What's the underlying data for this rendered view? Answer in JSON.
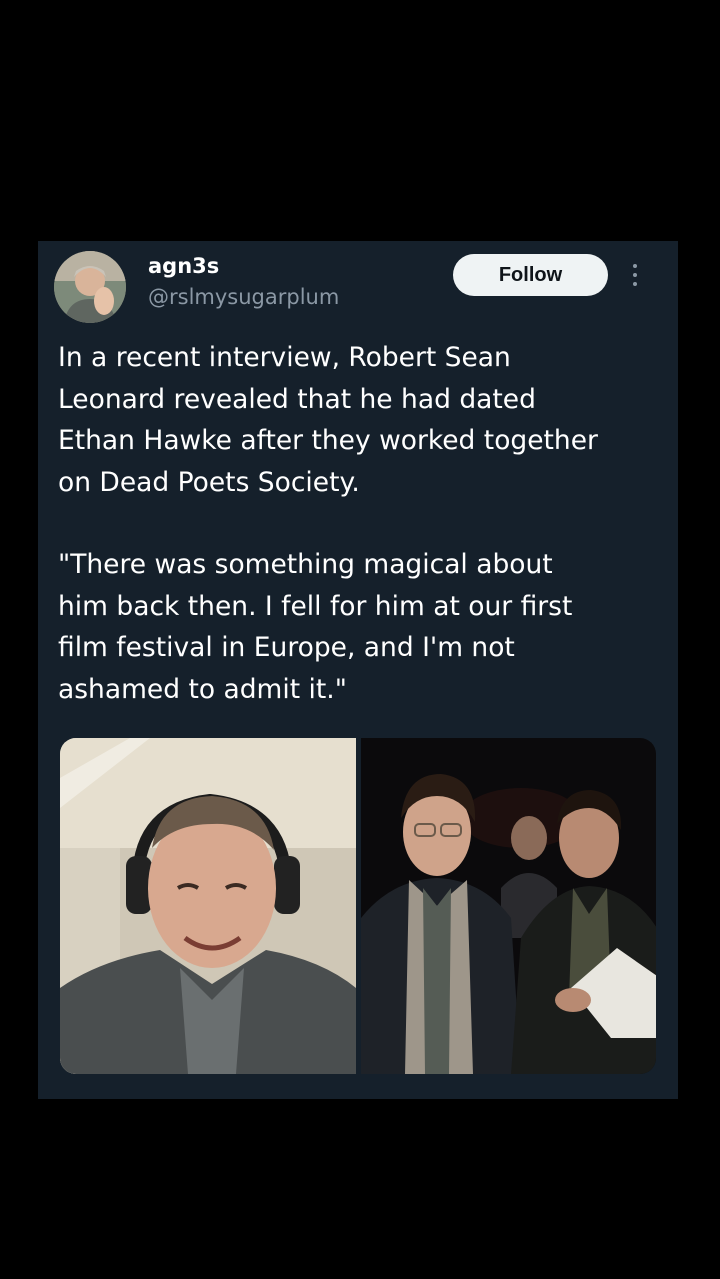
{
  "post": {
    "author": {
      "display_name": "agn3s",
      "handle": "@rslmysugarplum",
      "avatar_icon": "user-avatar"
    },
    "follow_label": "Follow",
    "more_icon": "more-vertical-icon",
    "paragraphs": [
      "In a recent interview, Robert Sean\nLeonard revealed that he had dated\nEthan Hawke after they worked together\non Dead Poets Society.",
      "\"There was something magical about\nhim back then. I fell for him at our first\nfilm festival in Europe, and I'm not\nashamed to admit it.\""
    ],
    "media": [
      {
        "kind": "photo",
        "subject": "man with headphones smiling"
      },
      {
        "kind": "photo",
        "subject": "two young men seated at an event"
      }
    ]
  },
  "colors": {
    "page_bg": "#000000",
    "card_bg": "#15202b",
    "text_primary": "#ffffff",
    "text_secondary": "#8b98a5",
    "follow_bg": "#eff3f4",
    "follow_text": "#0f1419"
  }
}
